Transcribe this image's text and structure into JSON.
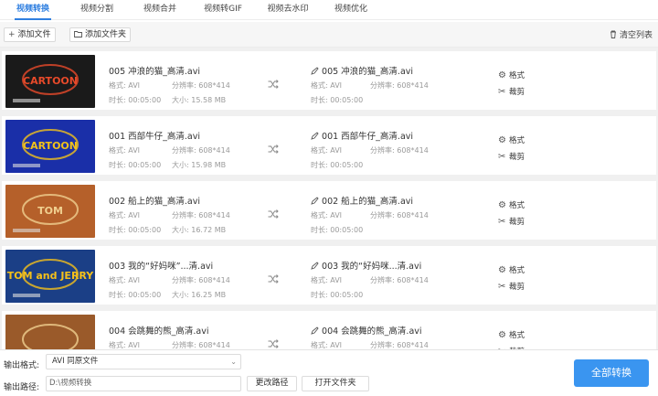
{
  "tabs": [
    {
      "label": "视频转换",
      "active": true
    },
    {
      "label": "视频分割",
      "active": false
    },
    {
      "label": "视频合并",
      "active": false
    },
    {
      "label": "视频转GIF",
      "active": false
    },
    {
      "label": "视频去水印",
      "active": false
    },
    {
      "label": "视频优化",
      "active": false
    }
  ],
  "toolbar": {
    "add_file": "添加文件",
    "add_folder": "添加文件夹",
    "clear_list": "清空列表"
  },
  "labels": {
    "format": "格式:",
    "resolution": "分辨率:",
    "duration": "时长:",
    "size": "大小:",
    "format_action": "格式",
    "trim_action": "裁剪"
  },
  "files": [
    {
      "name": "005 冲浪的猫_高清.avi",
      "out_name": "005 冲浪的猫_高清.avi",
      "format": "AVI",
      "resolution": "608*414",
      "duration": "00:05:00",
      "size": "15.58 MB",
      "out_format": "AVI",
      "out_resolution": "608*414",
      "out_duration": "00:05:00",
      "thumb_text": "CARTOON"
    },
    {
      "name": "001 西部牛仔_高清.avi",
      "out_name": "001 西部牛仔_高清.avi",
      "format": "AVI",
      "resolution": "608*414",
      "duration": "00:05:00",
      "size": "15.98 MB",
      "out_format": "AVI",
      "out_resolution": "608*414",
      "out_duration": "00:05:00",
      "thumb_text": "CARTOON"
    },
    {
      "name": "002 船上的猫_高清.avi",
      "out_name": "002 船上的猫_高清.avi",
      "format": "AVI",
      "resolution": "608*414",
      "duration": "00:05:00",
      "size": "16.72 MB",
      "out_format": "AVI",
      "out_resolution": "608*414",
      "out_duration": "00:05:00",
      "thumb_text": "TOM"
    },
    {
      "name": "003 我的“好妈咪”...清.avi",
      "out_name": "003 我的“好妈咪...清.avi",
      "format": "AVI",
      "resolution": "608*414",
      "duration": "00:05:00",
      "size": "16.25 MB",
      "out_format": "AVI",
      "out_resolution": "608*414",
      "out_duration": "00:05:00",
      "thumb_text": "TOM and JERRY"
    },
    {
      "name": "004 会跳舞的熊_高清.avi",
      "out_name": "004 会跳舞的熊_高清.avi",
      "format": "AVI",
      "resolution": "608*414",
      "duration": "00:05:00",
      "size": "",
      "out_format": "AVI",
      "out_resolution": "608*414",
      "out_duration": "",
      "thumb_text": ""
    }
  ],
  "bottom": {
    "output_format_label": "输出格式:",
    "output_format_value": "AVI  同原文件",
    "output_path_label": "输出路径:",
    "output_path_value": "D:\\视频转换",
    "change_path": "更改路径",
    "open_folder": "打开文件夹",
    "convert_all": "全部转换"
  },
  "colors": {
    "accent": "#2f7fe0",
    "convert_button": "#3a95f0"
  }
}
